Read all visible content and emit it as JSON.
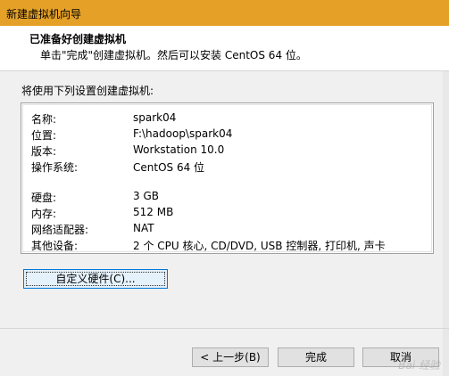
{
  "window": {
    "title": "新建虚拟机向导"
  },
  "header": {
    "title": "已准备好创建虚拟机",
    "subtitle": "单击\"完成\"创建虚拟机。然后可以安装 CentOS 64 位。"
  },
  "intro": "将使用下列设置创建虚拟机:",
  "summary": [
    {
      "key": "名称:",
      "value": "spark04"
    },
    {
      "key": "位置:",
      "value": "F:\\hadoop\\spark04"
    },
    {
      "key": "版本:",
      "value": "Workstation 10.0"
    },
    {
      "key": "操作系统:",
      "value": "CentOS 64 位"
    },
    {
      "key": "硬盘:",
      "value": "3 GB"
    },
    {
      "key": "内存:",
      "value": "512 MB"
    },
    {
      "key": "网络适配器:",
      "value": "NAT"
    },
    {
      "key": "其他设备:",
      "value": "2 个 CPU 核心, CD/DVD, USB 控制器, 打印机, 声卡"
    }
  ],
  "buttons": {
    "customize": "自定义硬件(C)...",
    "back": "< 上一步(B)",
    "finish": "完成",
    "cancel": "取消"
  },
  "watermark": "Bai 经验"
}
